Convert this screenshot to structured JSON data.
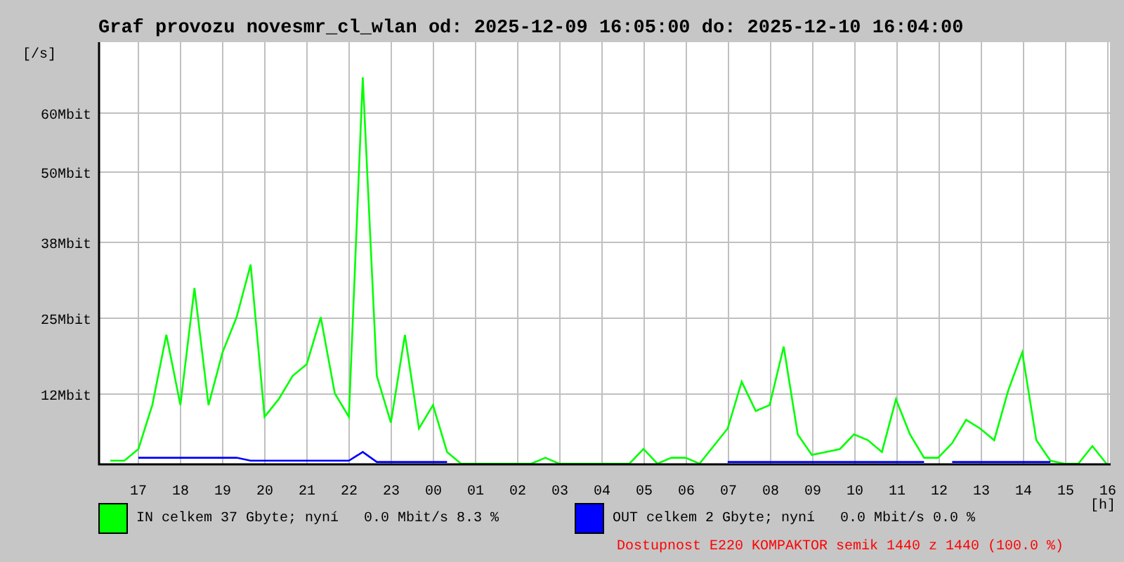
{
  "title": "Graf provozu novesmr_cl_wlan od: 2025-12-09 16:05:00 do: 2025-12-10 16:04:00",
  "chart": {
    "chart_data": {
      "type": "line",
      "ylabel": "[/s]",
      "xlabel": "[h]",
      "categories": [
        null,
        null,
        "17",
        null,
        null,
        "18",
        null,
        null,
        "19",
        null,
        null,
        "20",
        null,
        null,
        "21",
        null,
        null,
        "22",
        null,
        null,
        "23",
        null,
        null,
        "00",
        null,
        null,
        "01",
        null,
        null,
        "02",
        null,
        null,
        "03",
        null,
        null,
        "04",
        null,
        null,
        "05",
        null,
        null,
        "06",
        null,
        null,
        "07",
        null,
        null,
        "08",
        null,
        null,
        "09",
        null,
        null,
        "10",
        null,
        null,
        "11",
        null,
        null,
        "12",
        null,
        null,
        "13",
        null,
        null,
        "14",
        null,
        null,
        "15",
        null,
        null,
        "16"
      ],
      "series": [
        {
          "color": "#00ff00",
          "values": [
            0.5,
            0.5,
            2.5,
            10,
            22,
            10,
            30,
            10,
            19,
            25,
            34,
            8,
            11,
            15,
            17,
            25,
            12,
            8,
            66,
            15,
            7,
            22,
            6,
            10,
            2,
            0,
            0,
            0,
            0,
            0,
            0,
            1,
            0,
            0,
            0,
            0,
            0,
            0,
            2.5,
            0,
            1,
            1,
            0,
            3,
            6,
            14,
            9,
            10,
            20,
            5,
            1.5,
            2,
            2.5,
            5,
            4,
            2,
            11,
            5,
            1,
            1,
            3.5,
            7.5,
            6,
            4,
            12.5,
            19,
            4,
            0.5,
            0,
            0,
            3,
            0
          ]
        },
        {
          "color": "#0000ff",
          "values": [
            null,
            null,
            1,
            1,
            1,
            1,
            1,
            1,
            1,
            1,
            0.5,
            0.5,
            0.5,
            0.5,
            0.5,
            0.5,
            0.5,
            0.5,
            2,
            0.3,
            0.3,
            0.3,
            0.3,
            0.3,
            0.3,
            null,
            null,
            null,
            null,
            null,
            null,
            null,
            null,
            null,
            null,
            null,
            null,
            null,
            null,
            null,
            null,
            null,
            null,
            null,
            0.3,
            0.3,
            0.3,
            0.3,
            0.3,
            0.3,
            0.3,
            0.3,
            0.3,
            0.3,
            0.3,
            0.3,
            0.3,
            0.3,
            0.3,
            null,
            0.3,
            0.3,
            0.3,
            0.3,
            0.3,
            0.3,
            0.3,
            0.3,
            null,
            null,
            null,
            null
          ]
        }
      ],
      "ylim": [
        0,
        72
      ],
      "grid": true,
      "yticks": [
        {
          "value": 12,
          "label": "12Mbit"
        },
        {
          "value": 25,
          "label": "25Mbit"
        },
        {
          "value": 38,
          "label": "38Mbit"
        },
        {
          "value": 50,
          "label": "50Mbit"
        },
        {
          "value": 60,
          "label": "60Mbit"
        }
      ]
    }
  },
  "legend": [
    {
      "label": "IN celkem 37 Gbyte; nyní   0.0 Mbit/s 8.3 %",
      "color": "#00ff00"
    },
    {
      "label": "OUT celkem 2 Gbyte; nyní   0.0 Mbit/s 0.0 %",
      "color": "#0000ff"
    }
  ],
  "availability": "Dostupnost E220 KOMPAKTOR semik 1440 z 1440 (100.0 %)"
}
